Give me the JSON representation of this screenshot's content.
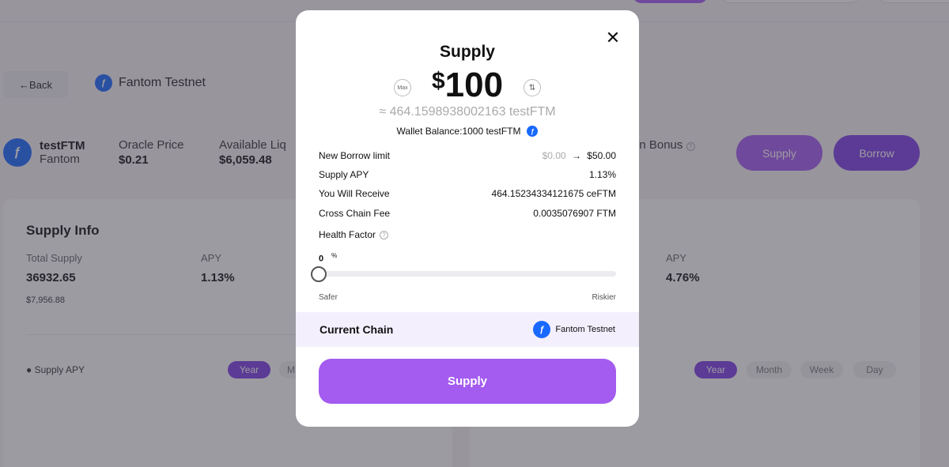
{
  "background": {
    "back_label": "←Back",
    "network": "Fantom Testnet",
    "asset": {
      "symbol": "testFTM",
      "chain": "Fantom"
    },
    "stats": [
      {
        "label": "Oracle Price",
        "value": "$0.21"
      },
      {
        "label": "Available Liq",
        "value": "$6,059.48"
      }
    ],
    "bonus_label": "on Bonus",
    "supply_button": "Supply",
    "borrow_button": "Borrow",
    "supply_info": {
      "title": "Supply Info",
      "total_supply_label": "Total Supply",
      "total_supply_value": "36932.65",
      "total_supply_usd": "$7,956.88",
      "apy_label": "APY",
      "apy_value": "1.13%",
      "chart_legend": "Supply APY",
      "periods": [
        "Year",
        "M"
      ]
    },
    "borrow_info": {
      "apy_label": "APY",
      "apy_value": "4.76%",
      "periods": [
        "Year",
        "Month",
        "Week",
        "Day"
      ]
    }
  },
  "modal": {
    "title": "Supply",
    "max_label": "Max",
    "swap_icon": "⇅",
    "currency": "$",
    "amount": "100",
    "approx_tokens": "≈ 464.1598938002163 testFTM",
    "wallet_balance": "Wallet Balance:1000 testFTM",
    "rows": [
      {
        "label": "New Borrow limit",
        "from": "$0.00",
        "arrow": "→",
        "value": "$50.00"
      },
      {
        "label": "Supply APY",
        "value": "1.13%"
      },
      {
        "label": "You Will Receive",
        "value": "464.15234334121675 ceFTM"
      },
      {
        "label": "Cross Chain Fee",
        "value": "0.0035076907 FTM"
      }
    ],
    "health_factor_label": "Health Factor",
    "slider_value": "0",
    "slider_unit": "%",
    "slider_fraction": 0,
    "safer_label": "Safer",
    "riskier_label": "Riskier",
    "current_chain_label": "Current Chain",
    "current_chain_value": "Fantom Testnet",
    "supply_button": "Supply"
  },
  "colors": {
    "accent": "#a35bf0",
    "accent_dark": "#7b3fe4",
    "fantom": "#1969ff"
  }
}
